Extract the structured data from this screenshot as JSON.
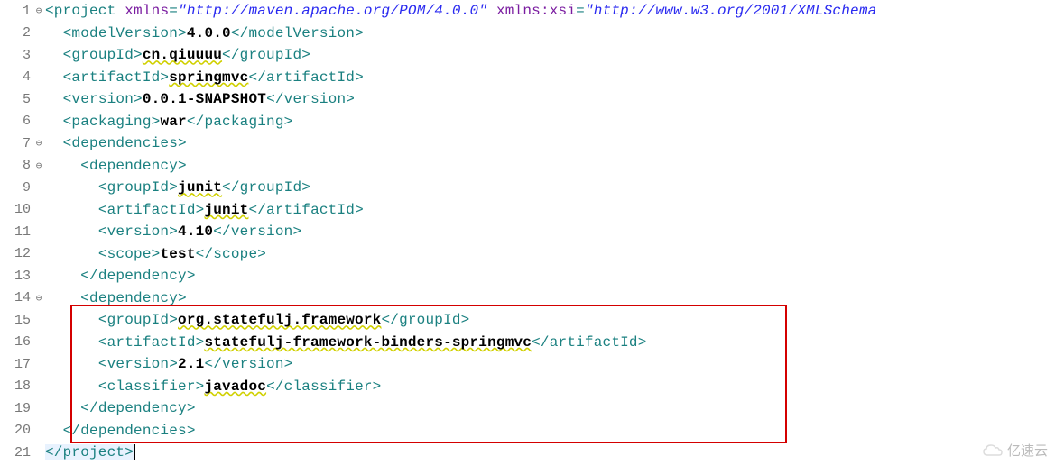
{
  "lines": [
    {
      "n": "1",
      "fold": "⊖",
      "indent": "",
      "segs": [
        {
          "t": "tag",
          "v": "<project"
        },
        {
          "t": "sp",
          "v": " "
        },
        {
          "t": "attr-name",
          "v": "xmlns"
        },
        {
          "t": "tag",
          "v": "="
        },
        {
          "t": "attr-val",
          "v": "\"http://maven.apache.org/POM/4.0.0\""
        },
        {
          "t": "sp",
          "v": " "
        },
        {
          "t": "attr-name",
          "v": "xmlns:xsi"
        },
        {
          "t": "tag",
          "v": "="
        },
        {
          "t": "attr-val",
          "v": "\"http://www.w3.org/2001/XMLSchema"
        }
      ]
    },
    {
      "n": "2",
      "fold": "",
      "indent": "  ",
      "segs": [
        {
          "t": "tag",
          "v": "<modelVersion>"
        },
        {
          "t": "txt-val",
          "v": "4.0.0"
        },
        {
          "t": "tag",
          "v": "</modelVersion>"
        }
      ]
    },
    {
      "n": "3",
      "fold": "",
      "indent": "  ",
      "segs": [
        {
          "t": "tag",
          "v": "<groupId>"
        },
        {
          "t": "squiggle",
          "v": "cn.qiuuuu"
        },
        {
          "t": "tag",
          "v": "</groupId>"
        }
      ]
    },
    {
      "n": "4",
      "fold": "",
      "indent": "  ",
      "segs": [
        {
          "t": "tag",
          "v": "<artifactId>"
        },
        {
          "t": "squiggle",
          "v": "springmvc"
        },
        {
          "t": "tag",
          "v": "</artifactId>"
        }
      ]
    },
    {
      "n": "5",
      "fold": "",
      "indent": "  ",
      "segs": [
        {
          "t": "tag",
          "v": "<version>"
        },
        {
          "t": "txt-val",
          "v": "0.0.1-SNAPSHOT"
        },
        {
          "t": "tag",
          "v": "</version>"
        }
      ]
    },
    {
      "n": "6",
      "fold": "",
      "indent": "  ",
      "segs": [
        {
          "t": "tag",
          "v": "<packaging>"
        },
        {
          "t": "txt-val",
          "v": "war"
        },
        {
          "t": "tag",
          "v": "</packaging>"
        }
      ]
    },
    {
      "n": "7",
      "fold": "⊖",
      "indent": "  ",
      "segs": [
        {
          "t": "tag",
          "v": "<dependencies>"
        }
      ]
    },
    {
      "n": "8",
      "fold": "⊖",
      "indent": "    ",
      "segs": [
        {
          "t": "tag",
          "v": "<dependency>"
        }
      ]
    },
    {
      "n": "9",
      "fold": "",
      "indent": "      ",
      "segs": [
        {
          "t": "tag",
          "v": "<groupId>"
        },
        {
          "t": "squiggle",
          "v": "junit"
        },
        {
          "t": "tag",
          "v": "</groupId>"
        }
      ]
    },
    {
      "n": "10",
      "fold": "",
      "indent": "      ",
      "segs": [
        {
          "t": "tag",
          "v": "<artifactId>"
        },
        {
          "t": "squiggle",
          "v": "junit"
        },
        {
          "t": "tag",
          "v": "</artifactId>"
        }
      ]
    },
    {
      "n": "11",
      "fold": "",
      "indent": "      ",
      "segs": [
        {
          "t": "tag",
          "v": "<version>"
        },
        {
          "t": "txt-val",
          "v": "4.10"
        },
        {
          "t": "tag",
          "v": "</version>"
        }
      ]
    },
    {
      "n": "12",
      "fold": "",
      "indent": "      ",
      "segs": [
        {
          "t": "tag",
          "v": "<scope>"
        },
        {
          "t": "txt-val",
          "v": "test"
        },
        {
          "t": "tag",
          "v": "</scope>"
        }
      ]
    },
    {
      "n": "13",
      "fold": "",
      "indent": "    ",
      "segs": [
        {
          "t": "tag",
          "v": "</dependency>"
        }
      ]
    },
    {
      "n": "14",
      "fold": "⊖",
      "indent": "    ",
      "segs": [
        {
          "t": "tag",
          "v": "<dependency>"
        }
      ]
    },
    {
      "n": "15",
      "fold": "",
      "indent": "      ",
      "segs": [
        {
          "t": "tag",
          "v": "<groupId>"
        },
        {
          "t": "squiggle",
          "v": "org.statefulj.framework"
        },
        {
          "t": "tag",
          "v": "</groupId>"
        }
      ]
    },
    {
      "n": "16",
      "fold": "",
      "indent": "      ",
      "segs": [
        {
          "t": "tag",
          "v": "<artifactId>"
        },
        {
          "t": "squiggle",
          "v": "statefulj-framework-binders-springmvc"
        },
        {
          "t": "tag",
          "v": "</artifactId>"
        }
      ]
    },
    {
      "n": "17",
      "fold": "",
      "indent": "      ",
      "segs": [
        {
          "t": "tag",
          "v": "<version>"
        },
        {
          "t": "txt-val",
          "v": "2.1"
        },
        {
          "t": "tag",
          "v": "</version>"
        }
      ]
    },
    {
      "n": "18",
      "fold": "",
      "indent": "      ",
      "segs": [
        {
          "t": "tag",
          "v": "<classifier>"
        },
        {
          "t": "squiggle",
          "v": "javadoc"
        },
        {
          "t": "tag",
          "v": "</classifier>"
        }
      ]
    },
    {
      "n": "19",
      "fold": "",
      "indent": "    ",
      "segs": [
        {
          "t": "tag",
          "v": "</dependency>"
        }
      ]
    },
    {
      "n": "20",
      "fold": "",
      "indent": "  ",
      "segs": [
        {
          "t": "tag",
          "v": "</dependencies>"
        }
      ]
    },
    {
      "n": "21",
      "fold": "",
      "indent": "",
      "hl": true,
      "segs": [
        {
          "t": "tag",
          "v": "</project>"
        }
      ],
      "cursor": true
    }
  ],
  "watermark": "亿速云"
}
